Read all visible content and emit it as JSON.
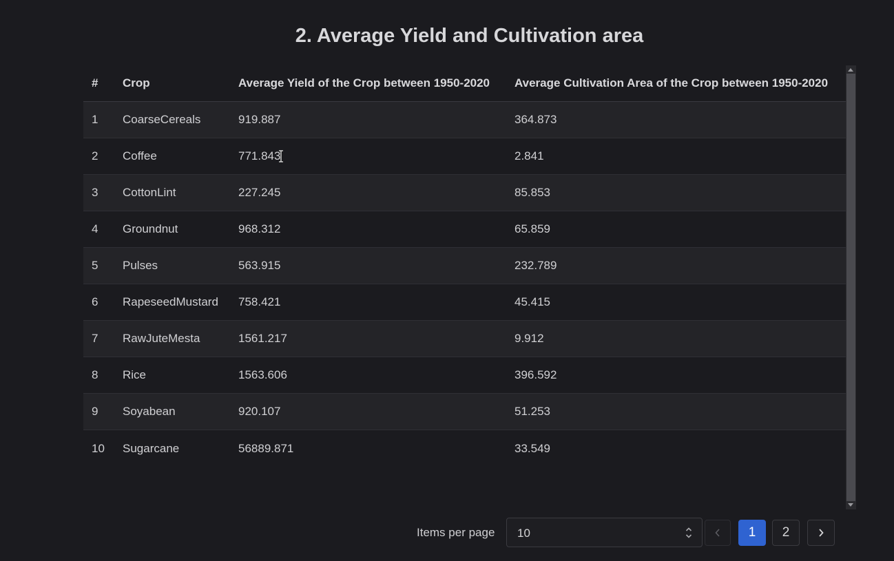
{
  "title": "2. Average Yield and Cultivation area",
  "table": {
    "headers": [
      "#",
      "Crop",
      "Average Yield of the Crop between 1950-2020",
      "Average Cultivation Area of the Crop between 1950-2020"
    ],
    "rows": [
      [
        "1",
        "CoarseCereals",
        "919.887",
        "364.873"
      ],
      [
        "2",
        "Coffee",
        "771.843",
        "2.841"
      ],
      [
        "3",
        "CottonLint",
        "227.245",
        "85.853"
      ],
      [
        "4",
        "Groundnut",
        "968.312",
        "65.859"
      ],
      [
        "5",
        "Pulses",
        "563.915",
        "232.789"
      ],
      [
        "6",
        "RapeseedMustard",
        "758.421",
        "45.415"
      ],
      [
        "7",
        "RawJuteMesta",
        "1561.217",
        "9.912"
      ],
      [
        "8",
        "Rice",
        "1563.606",
        "396.592"
      ],
      [
        "9",
        "Soyabean",
        "920.107",
        "51.253"
      ],
      [
        "10",
        "Sugarcane",
        "56889.871",
        "33.549"
      ]
    ]
  },
  "pagination": {
    "items_per_page_label": "Items per page",
    "items_per_page_value": "10",
    "pages": [
      "1",
      "2"
    ],
    "current_page": "1",
    "prev_icon": "chevron-left-icon",
    "next_icon": "chevron-right-icon"
  },
  "colors": {
    "background": "#1b1b1f",
    "active_page": "#2f63d1"
  }
}
